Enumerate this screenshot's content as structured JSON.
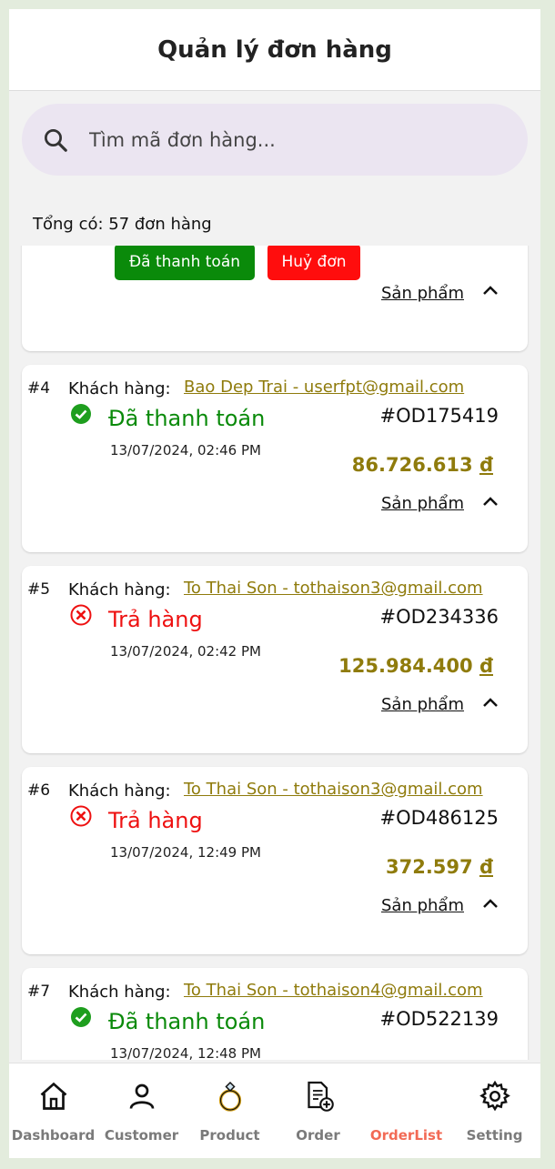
{
  "header": {
    "title": "Quản lý đơn hàng"
  },
  "search": {
    "placeholder": "Tìm mã đơn hàng..."
  },
  "summary": {
    "total_text": "Tổng có: 57 đơn hàng"
  },
  "partial_card": {
    "paid_button": "Đã thanh toán",
    "cancel_button": "Huỷ đơn",
    "products_label": "Sản phẩm"
  },
  "orders": [
    {
      "number": "#4",
      "customer_label": "Khách hàng:",
      "customer": "Bao Dep Trai - userfpt@gmail.com",
      "status": "Đã thanh toán",
      "status_type": "paid",
      "code": "#OD175419",
      "date": "13/07/2024, 02:46 PM",
      "amount": "86.726.613",
      "currency": "đ",
      "products_label": "Sản phẩm"
    },
    {
      "number": "#5",
      "customer_label": "Khách hàng:",
      "customer": "To Thai Son - tothaison3@gmail.com",
      "status": "Trả hàng",
      "status_type": "return",
      "code": "#OD234336",
      "date": "13/07/2024, 02:42 PM",
      "amount": "125.984.400",
      "currency": "đ",
      "products_label": "Sản phẩm"
    },
    {
      "number": "#6",
      "customer_label": "Khách hàng:",
      "customer": "To Thai Son - tothaison3@gmail.com",
      "status": "Trả hàng",
      "status_type": "return",
      "code": "#OD486125",
      "date": "13/07/2024, 12:49 PM",
      "amount": "372.597",
      "currency": "đ",
      "products_label": "Sản phẩm"
    },
    {
      "number": "#7",
      "customer_label": "Khách hàng:",
      "customer": "To Thai Son - tothaison4@gmail.com",
      "status": "Đã thanh toán",
      "status_type": "paid",
      "code": "#OD522139",
      "date": "13/07/2024, 12:48 PM"
    }
  ],
  "nav": {
    "items": [
      {
        "label": "Dashboard",
        "icon": "home-icon"
      },
      {
        "label": "Customer",
        "icon": "user-icon"
      },
      {
        "label": "Product",
        "icon": "ring-icon"
      },
      {
        "label": "Order",
        "icon": "add-document-icon"
      },
      {
        "label": "OrderList",
        "icon": "receipt-icon",
        "active": true
      },
      {
        "label": "Setting",
        "icon": "gear-icon"
      }
    ]
  },
  "colors": {
    "paid": "#0a8a0a",
    "return": "#ee1111",
    "accent_link": "#8f7b0c",
    "active_tab": "#f26a55"
  }
}
